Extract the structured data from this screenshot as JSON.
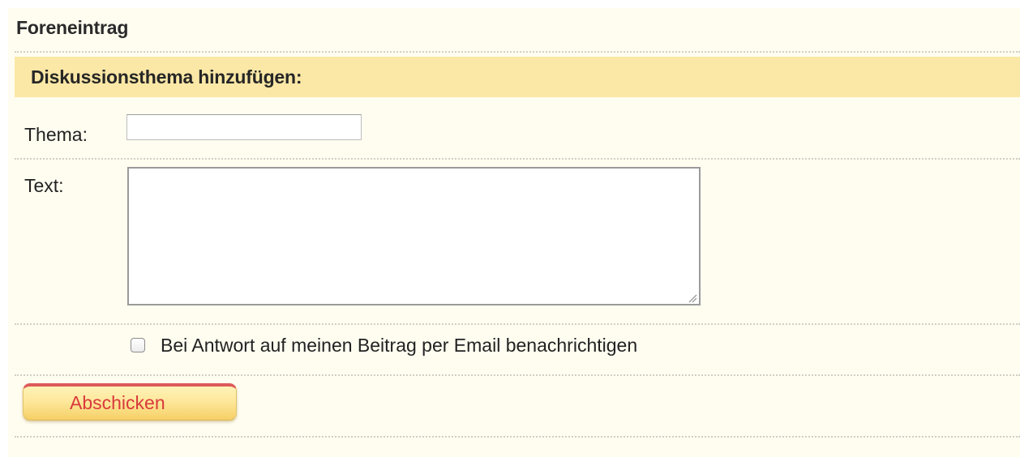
{
  "page": {
    "title": "Foreneintrag"
  },
  "form": {
    "section_title": "Diskussionsthema hinzufügen:",
    "subject": {
      "label": "Thema:",
      "value": ""
    },
    "body": {
      "label": "Text:",
      "value": ""
    },
    "notify": {
      "label": "Bei Antwort auf meinen Beitrag per Email benachrichtigen",
      "checked": false
    },
    "submit_label": "Abschicken"
  },
  "colors": {
    "panel_background": "#fffdf0",
    "section_header_background": "#fce8a6",
    "button_accent": "#de5a5a",
    "button_text": "#d9393c"
  }
}
